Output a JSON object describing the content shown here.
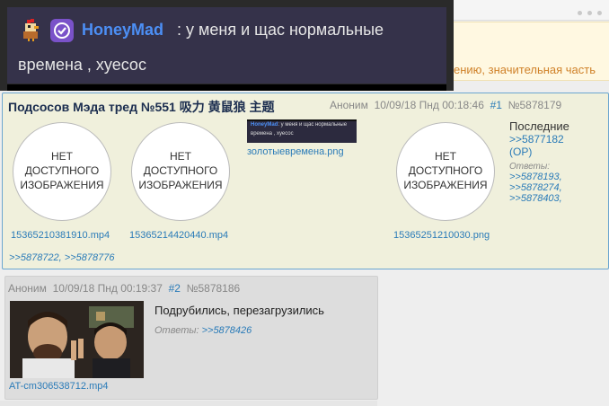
{
  "overlay": {
    "username": "HoneyMad",
    "line1": ": у меня и щас нормальные",
    "line2": "времена , хуесос"
  },
  "notice": {
    "text": "ению, значительная часть"
  },
  "op": {
    "title": "Подсосов Мэда тред №551 吸力 黄鼠狼 主题",
    "author": "Аноним",
    "date": "10/09/18 Пнд 00:18:46",
    "index": "#1",
    "post_no": "№5878179",
    "no_image_text": "НЕТ ДОСТУПНОГО ИЗОБРАЖЕНИЯ",
    "files": [
      "15365210381910.mp4",
      "15365214420440.mp4",
      "золотыевремена.png",
      "15365251210030.png"
    ],
    "mini_thumb": {
      "name": "HoneyMad",
      "line1": ": у меня и щас нормальные",
      "line2": "времена , хуесос"
    },
    "last_label": "Последние",
    "last_link": ">>5877182",
    "op_marker": "(OP)",
    "replies_label": "Ответы:",
    "replies": [
      ">>5878193,",
      ">>5878274,",
      ">>5878403,"
    ],
    "bottom_replies": ">>5878722, >>5878776"
  },
  "reply": {
    "author": "Аноним",
    "date": "10/09/18 Пнд 00:19:37",
    "index": "#2",
    "post_no": "№5878186",
    "text": "Подрубились, перезагрузились",
    "answers_label": "Ответы:",
    "answers_ref": ">>5878426",
    "file": "AT-cm306538712.mp4"
  },
  "colors": {
    "accent_link": "#2a7bb8",
    "op_bg": "#f0f0dc",
    "reply_bg": "#dddddd",
    "username": "#4c8ff5",
    "badge": "#7a52c9"
  }
}
